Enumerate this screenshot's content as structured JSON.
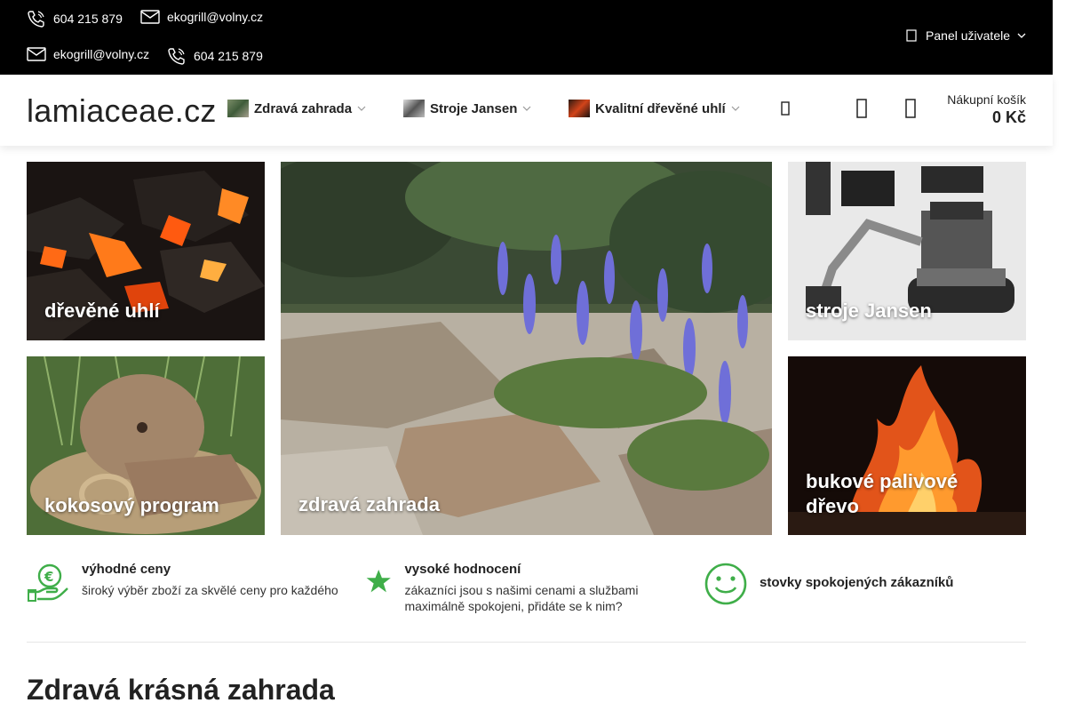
{
  "topbar": {
    "phone_1": "604 215 879",
    "email_1": "ekogrill@volny.cz",
    "email_2": "ekogrill@volny.cz",
    "phone_2": "604 215 879",
    "user_panel": "Panel uživatele"
  },
  "header": {
    "logo": "lamiaceae.cz",
    "nav": [
      {
        "label": "Zdravá zahrada"
      },
      {
        "label": "Stroje Jansen"
      },
      {
        "label": "Kvalitní dřevěné uhlí"
      }
    ],
    "cart_label": "Nákupní košík",
    "cart_total": "0 Kč"
  },
  "tiles": [
    {
      "label": "dřevěné uhlí"
    },
    {
      "label": "zdravá zahrada"
    },
    {
      "label": "stroje Jansen"
    },
    {
      "label": "kokosový program"
    },
    {
      "label": "bukové palivové dřevo"
    }
  ],
  "benefits": [
    {
      "title": "výhodné ceny",
      "desc": "široký výběr zboží za skvělé ceny pro každého"
    },
    {
      "title": "vysoké hodnocení",
      "desc": "zákazníci jsou s našimi cenami a službami maximálně spokojeni, přidáte se k nim?"
    },
    {
      "title": "stovky spokojených zákazníků",
      "desc": ""
    }
  ],
  "section_title": "Zdravá krásná zahrada",
  "colors": {
    "accent_green": "#3fae49",
    "topbar": "#000000"
  }
}
